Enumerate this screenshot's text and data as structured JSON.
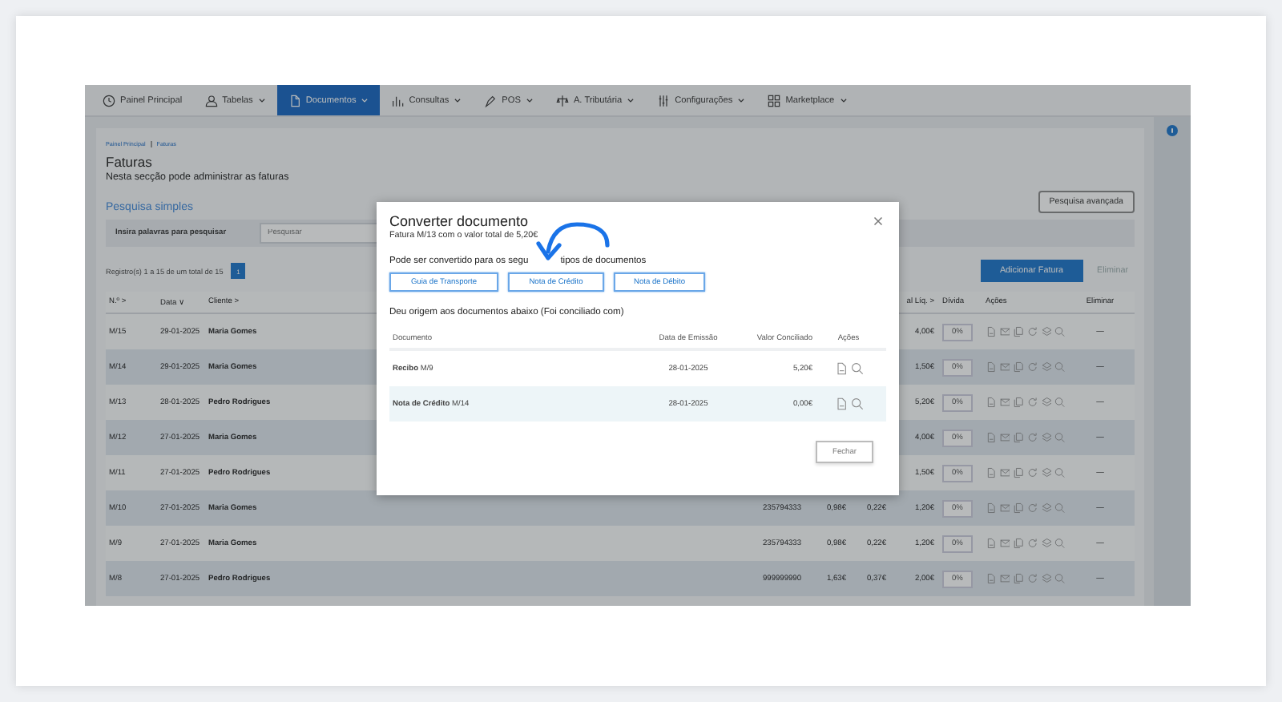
{
  "nav": [
    {
      "label": "Painel Principal",
      "selected": false,
      "menu": false
    },
    {
      "label": "Tabelas",
      "selected": false,
      "menu": true
    },
    {
      "label": "Documentos",
      "selected": true,
      "menu": true
    },
    {
      "label": "Consultas",
      "selected": false,
      "menu": true
    },
    {
      "label": "POS",
      "selected": false,
      "menu": true
    },
    {
      "label": "A. Tributária",
      "selected": false,
      "menu": true
    },
    {
      "label": "Configurações",
      "selected": false,
      "menu": true
    },
    {
      "label": "Marketplace",
      "selected": false,
      "menu": true
    }
  ],
  "breadcrumb": [
    "Painel Principal",
    "Faturas"
  ],
  "page": {
    "title": "Faturas",
    "subtitle": "Nesta secção pode administrar as faturas"
  },
  "search": {
    "heading": "Pesquisa simples",
    "label": "Insira palavras para pesquisar",
    "placeholder": "Pesquisar",
    "advanced_button": "Pesquisa avançada"
  },
  "records": "Registro(s) 1 a 15 de um total de 15",
  "pages": [
    {
      "label": "1",
      "selected": true
    }
  ],
  "add_button": "Adicionar Fatura",
  "delete_button": "Eliminar",
  "table": {
    "columns": {
      "number": "N.º >",
      "date": "Data ∨",
      "client": "Cliente >",
      "total": "al Líq. >",
      "debt": "Dívida",
      "actions": "Ações",
      "delete": "Eliminar"
    },
    "rows": [
      {
        "number": "M/15",
        "date": "29-01-2025",
        "client": "Maria Gomes",
        "total": "4,00€",
        "debt": "0%",
        "delete": "—"
      },
      {
        "number": "M/14",
        "date": "29-01-2025",
        "client": "Maria Gomes",
        "total": "1,50€",
        "debt": "0%",
        "delete": "—"
      },
      {
        "number": "M/13",
        "date": "28-01-2025",
        "client": "Pedro Rodrigues",
        "total": "5,20€",
        "debt": "0%",
        "delete": "—"
      },
      {
        "number": "M/12",
        "date": "27-01-2025",
        "client": "Maria Gomes",
        "total": "4,00€",
        "debt": "0%",
        "delete": "—"
      },
      {
        "number": "M/11",
        "date": "27-01-2025",
        "client": "Pedro Rodrigues",
        "total": "1,50€",
        "debt": "0%",
        "delete": "—"
      },
      {
        "number": "M/10",
        "date": "27-01-2025",
        "client": "Maria Gomes",
        "column_4": "235794333",
        "column_5": "0,98€",
        "column_6": "0,22€",
        "total": "1,20€",
        "debt": "0%",
        "delete": "—"
      },
      {
        "number": "M/9",
        "date": "27-01-2025",
        "client": "Maria Gomes",
        "column_4": "235794333",
        "column_5": "0,98€",
        "column_6": "0,22€",
        "total": "1,20€",
        "debt": "0%",
        "delete": "—"
      },
      {
        "number": "M/8",
        "date": "27-01-2025",
        "client": "Pedro Rodrigues",
        "column_4": "999999990",
        "column_5": "1,63€",
        "column_6": "0,37€",
        "total": "2,00€",
        "debt": "0%",
        "delete": "—"
      }
    ]
  },
  "modal": {
    "title": "Converter documento",
    "subtitle": "Fatura M/13 com o valor total de 5,20€",
    "convert_label": "Pode ser convertido para os segu",
    "convert_label_end": "tipos de documentos",
    "convert_options": [
      "Guia de Transporte",
      "Nota de Crédito",
      "Nota de Débito"
    ],
    "origin_label": "Deu origem aos documentos abaixo (Foi conciliado com)",
    "columns": [
      "Documento",
      "Data de Emissão",
      "Valor Conciliado",
      "Ações"
    ],
    "rows": [
      {
        "document": "**Recibo** M/9",
        "date": "28-01-2025",
        "value": "5,20€"
      },
      {
        "document": "**Nota de Crédito** M/14",
        "date": "28-01-2025",
        "value": "0,00€"
      }
    ],
    "close_button": "Fechar"
  }
}
